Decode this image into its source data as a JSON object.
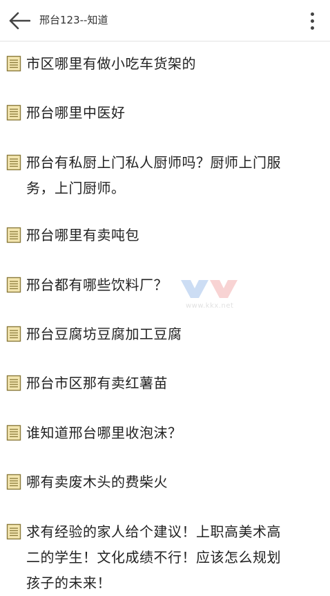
{
  "header": {
    "title": "邢台123--知道",
    "back_icon": "arrow-left-icon",
    "more_icon": "more-vertical-icon"
  },
  "items": [
    {
      "text": "市区哪里有做小吃车货架的"
    },
    {
      "text": "邢台哪里中医好"
    },
    {
      "text": "邢台有私厨上门私人厨师吗？厨师上门服务，上门厨师。"
    },
    {
      "text": "邢台哪里有卖吨包"
    },
    {
      "text": "邢台都有哪些饮料厂？"
    },
    {
      "text": "邢台豆腐坊豆腐加工豆腐"
    },
    {
      "text": "邢台市区那有卖红薯苗"
    },
    {
      "text": "谁知道邢台哪里收泡沫？"
    },
    {
      "text": "哪有卖废木头的费柴火"
    },
    {
      "text": "求有经验的家人给个建议！上职高美术高二的学生！文化成绩不行！应该怎么规划孩子的未来！"
    }
  ],
  "watermark": {
    "text": "www.kkx.net"
  },
  "colors": {
    "doc_icon_fill": "#f4e6b0",
    "doc_icon_border": "#8a7a3a",
    "divider": "#e2e2e2"
  }
}
